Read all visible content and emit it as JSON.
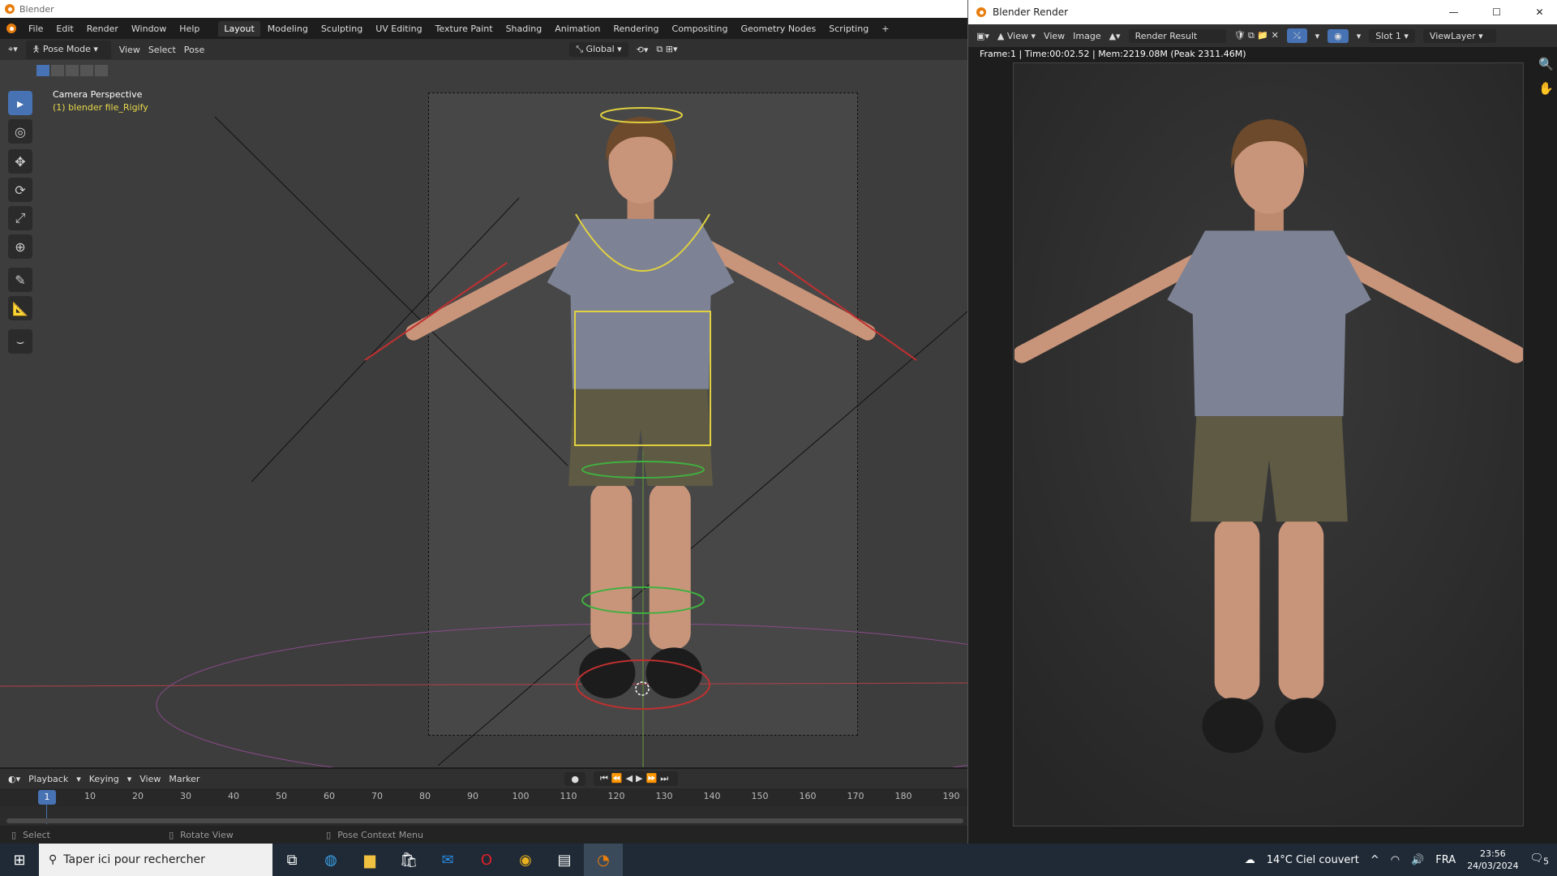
{
  "app_title": "Blender",
  "menu": [
    "File",
    "Edit",
    "Render",
    "Window",
    "Help"
  ],
  "workspaces": [
    "Layout",
    "Modeling",
    "Sculpting",
    "UV Editing",
    "Texture Paint",
    "Shading",
    "Animation",
    "Rendering",
    "Compositing",
    "Geometry Nodes",
    "Scripting"
  ],
  "add_workspace": "+",
  "viewport_header": {
    "mode": "Pose Mode",
    "menus": [
      "View",
      "Select",
      "Pose"
    ],
    "orientation": "Global"
  },
  "viewport_overlay": {
    "title": "Camera Perspective",
    "subtitle": "(1) blender file_Rigify"
  },
  "timeline": {
    "menus": [
      "Playback",
      "Keying",
      "View",
      "Marker"
    ],
    "current_frame": 1,
    "ticks": [
      "10",
      "20",
      "30",
      "40",
      "50",
      "60",
      "70",
      "80",
      "90",
      "100",
      "110",
      "120",
      "130",
      "140",
      "150",
      "160",
      "170",
      "180",
      "190"
    ],
    "current_label": "1"
  },
  "statusbar": {
    "select": "Select",
    "rotate": "Rotate View",
    "context": "Pose Context Menu"
  },
  "render_window": {
    "title": "Blender Render",
    "view_menu": "View",
    "menus": [
      "View",
      "Image"
    ],
    "image_name": "Render Result",
    "slot": "Slot 1",
    "view_layer": "ViewLayer",
    "info": "Frame:1 | Time:00:02.52 | Mem:2219.08M (Peak 2311.46M)",
    "min": "—",
    "max": "☐",
    "close": "✕"
  },
  "taskbar": {
    "search_placeholder": "Taper ici pour rechercher",
    "weather": "14°C  Ciel couvert",
    "language": "FRA",
    "time": "23:56",
    "date": "24/03/2024",
    "notifications": "5"
  },
  "colors": {
    "accent": "#4772b3",
    "skin": "#c9957a",
    "shirt": "#7d8395",
    "shorts": "#5f5a44",
    "hair": "#6e4a2c"
  }
}
